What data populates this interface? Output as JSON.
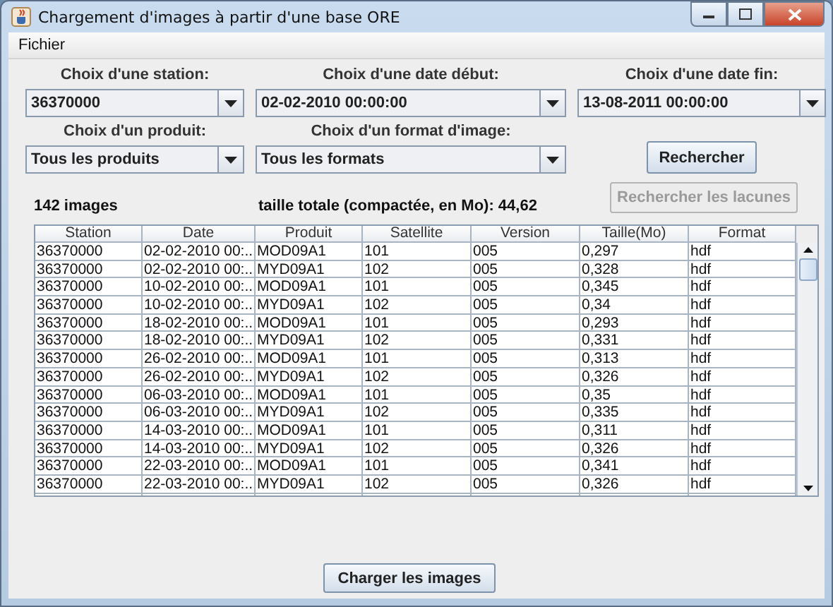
{
  "window": {
    "title": "Chargement d'images à partir d'une base ORE"
  },
  "menu": [
    "Fichier"
  ],
  "filters": [
    {
      "label": "Choix d'une station:",
      "value": "36370000"
    },
    {
      "label": "Choix d'une date début:",
      "value": "02-02-2010 00:00:00"
    },
    {
      "label": "Choix d'une date fin:",
      "value": "13-08-2011 00:00:00"
    },
    {
      "label": "Choix d'un produit:",
      "value": "Tous les produits"
    },
    {
      "label": "Choix d'un format d'image:",
      "value": "Tous les formats"
    }
  ],
  "search_button": {
    "label": "Rechercher",
    "disabled": false
  },
  "gaps_button": {
    "label": "Rechercher les lacunes",
    "disabled": true
  },
  "count": "142 images",
  "total_size": "taille totale (compactée, en Mo): 44,62",
  "table": {
    "columns": [
      "Station",
      "Date",
      "Produit",
      "Satellite",
      "Version",
      "Taille(Mo)",
      "Format"
    ],
    "rows": [
      [
        "36370000",
        "02-02-2010 00:...",
        "MOD09A1",
        "101",
        "005",
        "0,297",
        "hdf"
      ],
      [
        "36370000",
        "02-02-2010 00:...",
        "MYD09A1",
        "102",
        "005",
        "0,328",
        "hdf"
      ],
      [
        "36370000",
        "10-02-2010 00:...",
        "MOD09A1",
        "101",
        "005",
        "0,345",
        "hdf"
      ],
      [
        "36370000",
        "10-02-2010 00:...",
        "MYD09A1",
        "102",
        "005",
        "0,34",
        "hdf"
      ],
      [
        "36370000",
        "18-02-2010 00:...",
        "MOD09A1",
        "101",
        "005",
        "0,293",
        "hdf"
      ],
      [
        "36370000",
        "18-02-2010 00:...",
        "MYD09A1",
        "102",
        "005",
        "0,331",
        "hdf"
      ],
      [
        "36370000",
        "26-02-2010 00:...",
        "MOD09A1",
        "101",
        "005",
        "0,313",
        "hdf"
      ],
      [
        "36370000",
        "26-02-2010 00:...",
        "MYD09A1",
        "102",
        "005",
        "0,326",
        "hdf"
      ],
      [
        "36370000",
        "06-03-2010 00:...",
        "MOD09A1",
        "101",
        "005",
        "0,35",
        "hdf"
      ],
      [
        "36370000",
        "06-03-2010 00:...",
        "MYD09A1",
        "102",
        "005",
        "0,335",
        "hdf"
      ],
      [
        "36370000",
        "14-03-2010 00:...",
        "MOD09A1",
        "101",
        "005",
        "0,311",
        "hdf"
      ],
      [
        "36370000",
        "14-03-2010 00:...",
        "MYD09A1",
        "102",
        "005",
        "0,326",
        "hdf"
      ],
      [
        "36370000",
        "22-03-2010 00:...",
        "MOD09A1",
        "101",
        "005",
        "0,341",
        "hdf"
      ],
      [
        "36370000",
        "22-03-2010 00:...",
        "MYD09A1",
        "102",
        "005",
        "0,326",
        "hdf"
      ]
    ]
  },
  "load_button": {
    "label": "Charger les images",
    "disabled": false
  }
}
